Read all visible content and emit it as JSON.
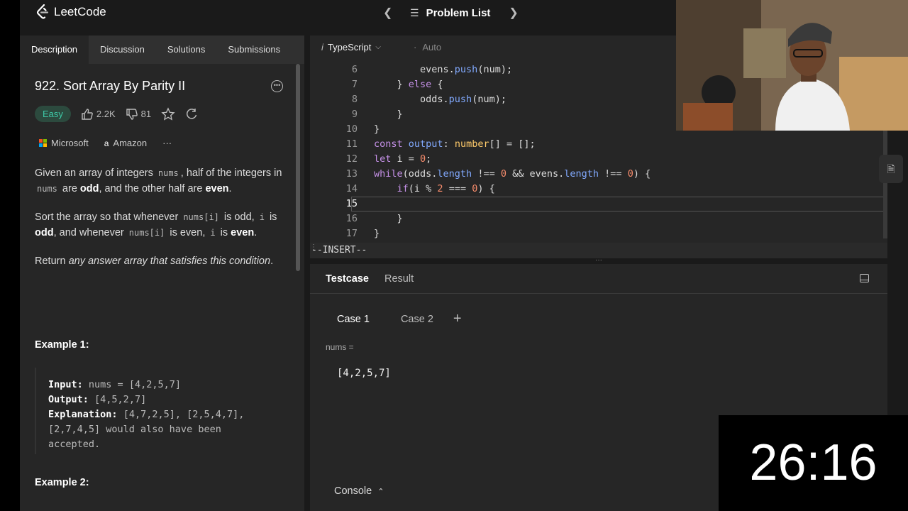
{
  "header": {
    "logo_text": "LeetCode",
    "problem_list_label": "Problem List"
  },
  "left_tabs": [
    "Description",
    "Discussion",
    "Solutions",
    "Submissions"
  ],
  "problem": {
    "title": "922. Sort Array By Parity II",
    "difficulty": "Easy",
    "likes": "2.2K",
    "dislikes": "81",
    "companies": [
      "Microsoft",
      "Amazon"
    ],
    "companies_more": "···",
    "p1": {
      "a": "Given an array of integers ",
      "code1": "nums",
      "b": ", half of the integers in ",
      "code2": "nums",
      "c": " are ",
      "d": "odd",
      "e": ", and the other half are ",
      "f": "even",
      "g": "."
    },
    "p2": {
      "a": "Sort the array so that whenever ",
      "code1": "nums[i]",
      "b": " is odd, ",
      "code2": "i",
      "c": " is ",
      "d": "odd",
      "e": ", and whenever ",
      "code3": "nums[i]",
      "f": " is even, ",
      "code4": "i",
      "g": " is ",
      "h": "even",
      "i": "."
    },
    "p3": {
      "a": "Return ",
      "b": "any answer array that satisfies this condition",
      "c": "."
    },
    "example1_title": "Example 1:",
    "example1": {
      "input_label": "Input:",
      "input": "nums = [4,2,5,7]",
      "output_label": "Output:",
      "output": "[4,5,2,7]",
      "explanation_label": "Explanation:",
      "explanation": "[4,7,2,5], [2,5,4,7], [2,7,4,5] would also have been accepted."
    },
    "example2_title": "Example 2:"
  },
  "editor": {
    "language": "TypeScript",
    "mode": "Auto",
    "vim_mode": "--INSERT--",
    "lines": [
      {
        "n": "6",
        "tokens": [
          [
            "pl",
            "        evens."
          ],
          [
            "fn",
            "push"
          ],
          [
            "pl",
            "(num);"
          ]
        ]
      },
      {
        "n": "7",
        "tokens": [
          [
            "pl",
            "    } "
          ],
          [
            "kw",
            "else"
          ],
          [
            "pl",
            " {"
          ]
        ]
      },
      {
        "n": "8",
        "tokens": [
          [
            "pl",
            "        odds."
          ],
          [
            "fn",
            "push"
          ],
          [
            "pl",
            "(num);"
          ]
        ]
      },
      {
        "n": "9",
        "tokens": [
          [
            "pl",
            "    }"
          ]
        ]
      },
      {
        "n": "10",
        "tokens": [
          [
            "pl",
            "}"
          ]
        ]
      },
      {
        "n": "11",
        "tokens": [
          [
            "kw",
            "const"
          ],
          [
            "pl",
            " "
          ],
          [
            "fn",
            "output"
          ],
          [
            "pl",
            ": "
          ],
          [
            "ty",
            "number"
          ],
          [
            "pl",
            "[] = [];"
          ]
        ]
      },
      {
        "n": "12",
        "tokens": [
          [
            "kw",
            "let"
          ],
          [
            "pl",
            " i = "
          ],
          [
            "num",
            "0"
          ],
          [
            "pl",
            ";"
          ]
        ]
      },
      {
        "n": "13",
        "tokens": [
          [
            "kw",
            "while"
          ],
          [
            "pl",
            "(odds."
          ],
          [
            "fn",
            "length"
          ],
          [
            "pl",
            " !== "
          ],
          [
            "num",
            "0"
          ],
          [
            "pl",
            " && evens."
          ],
          [
            "fn",
            "length"
          ],
          [
            "pl",
            " !== "
          ],
          [
            "num",
            "0"
          ],
          [
            "pl",
            ") {"
          ]
        ]
      },
      {
        "n": "14",
        "tokens": [
          [
            "pl",
            "    "
          ],
          [
            "kw",
            "if"
          ],
          [
            "pl",
            "(i % "
          ],
          [
            "num",
            "2"
          ],
          [
            "pl",
            " === "
          ],
          [
            "num",
            "0"
          ],
          [
            "pl",
            ") {"
          ]
        ]
      },
      {
        "n": "15",
        "tokens": [
          [
            "pl",
            ""
          ]
        ]
      },
      {
        "n": "16",
        "tokens": [
          [
            "pl",
            "    }"
          ]
        ]
      },
      {
        "n": "17",
        "tokens": [
          [
            "pl",
            "}"
          ]
        ]
      }
    ]
  },
  "testcase": {
    "tabs": [
      "Testcase",
      "Result"
    ],
    "cases": [
      "Case 1",
      "Case 2"
    ],
    "add_label": "+",
    "param_label": "nums =",
    "param_value": "[4,2,5,7]",
    "console_label": "Console"
  },
  "timer": "26:16",
  "colors": {
    "easy": "#3ec9a7",
    "background": "#1a1a1a",
    "panel": "#262626"
  }
}
